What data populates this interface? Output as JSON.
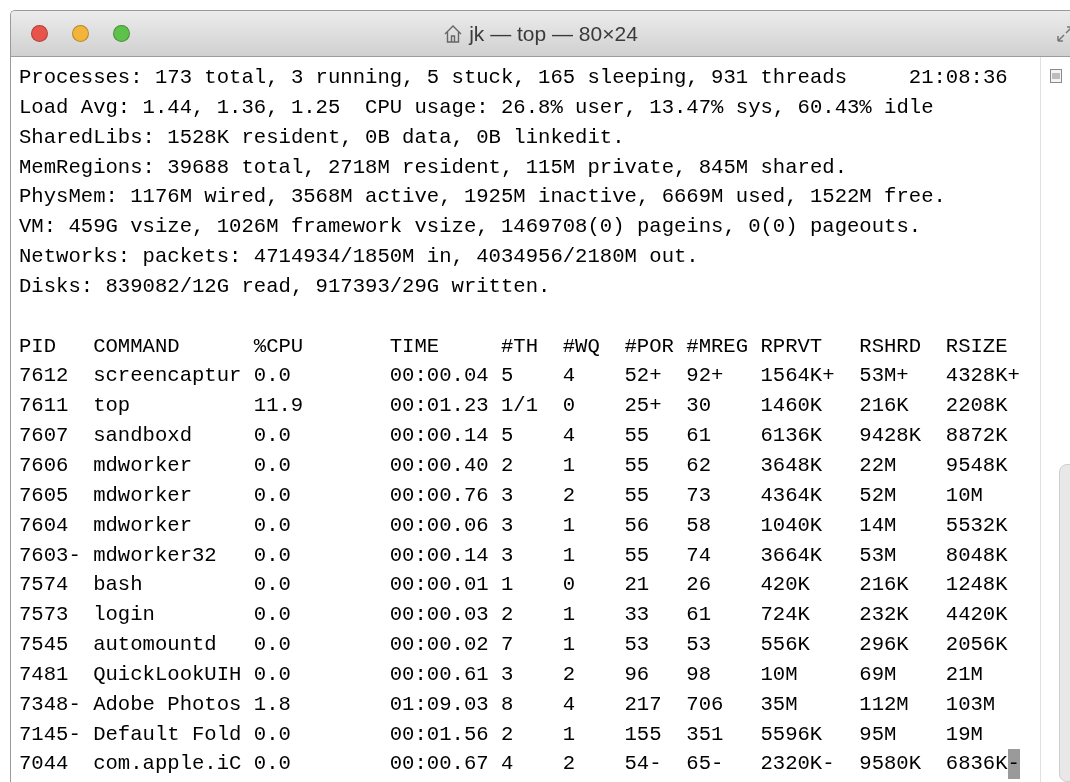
{
  "window": {
    "title": "jk — top — 80×24"
  },
  "summary": {
    "first_line": "Processes: 173 total, 3 running, 5 stuck, 165 sleeping, 931 threads",
    "clock": "21:08:36",
    "lines": [
      "Load Avg: 1.44, 1.36, 1.25  CPU usage: 26.8% user, 13.47% sys, 60.43% idle",
      "SharedLibs: 1528K resident, 0B data, 0B linkedit.",
      "MemRegions: 39688 total, 2718M resident, 115M private, 845M shared.",
      "PhysMem: 1176M wired, 3568M active, 1925M inactive, 6669M used, 1522M free.",
      "VM: 459G vsize, 1026M framework vsize, 1469708(0) pageins, 0(0) pageouts.",
      "Networks: packets: 4714934/1850M in, 4034956/2180M out.",
      "Disks: 839082/12G read, 917393/29G written."
    ]
  },
  "table": {
    "columns": [
      "PID",
      "COMMAND",
      "%CPU",
      "TIME",
      "#TH",
      "#WQ",
      "#POR",
      "#MREG",
      "RPRVT",
      "RSHRD",
      "RSIZE"
    ],
    "rows": [
      [
        "7612",
        "screencaptur",
        "0.0",
        "00:00.04",
        "5",
        "4",
        "52+",
        "92+",
        "1564K+",
        "53M+",
        "4328K+"
      ],
      [
        "7611",
        "top",
        "11.9",
        "00:01.23",
        "1/1",
        "0",
        "25+",
        "30",
        "1460K",
        "216K",
        "2208K"
      ],
      [
        "7607",
        "sandboxd",
        "0.0",
        "00:00.14",
        "5",
        "4",
        "55",
        "61",
        "6136K",
        "9428K",
        "8872K"
      ],
      [
        "7606",
        "mdworker",
        "0.0",
        "00:00.40",
        "2",
        "1",
        "55",
        "62",
        "3648K",
        "22M",
        "9548K"
      ],
      [
        "7605",
        "mdworker",
        "0.0",
        "00:00.76",
        "3",
        "2",
        "55",
        "73",
        "4364K",
        "52M",
        "10M"
      ],
      [
        "7604",
        "mdworker",
        "0.0",
        "00:00.06",
        "3",
        "1",
        "56",
        "58",
        "1040K",
        "14M",
        "5532K"
      ],
      [
        "7603-",
        "mdworker32",
        "0.0",
        "00:00.14",
        "3",
        "1",
        "55",
        "74",
        "3664K",
        "53M",
        "8048K"
      ],
      [
        "7574",
        "bash",
        "0.0",
        "00:00.01",
        "1",
        "0",
        "21",
        "26",
        "420K",
        "216K",
        "1248K"
      ],
      [
        "7573",
        "login",
        "0.0",
        "00:00.03",
        "2",
        "1",
        "33",
        "61",
        "724K",
        "232K",
        "4420K"
      ],
      [
        "7545",
        "automountd",
        "0.0",
        "00:00.02",
        "7",
        "1",
        "53",
        "53",
        "556K",
        "296K",
        "2056K"
      ],
      [
        "7481",
        "QuickLookUIH",
        "0.0",
        "00:00.61",
        "3",
        "2",
        "96",
        "98",
        "10M",
        "69M",
        "21M"
      ],
      [
        "7348-",
        "Adobe Photos",
        "1.8",
        "01:09.03",
        "8",
        "4",
        "217",
        "706",
        "35M",
        "112M",
        "103M"
      ],
      [
        "7145-",
        "Default Fold",
        "0.0",
        "00:01.56",
        "2",
        "1",
        "155",
        "351",
        "5596K",
        "95M",
        "19M"
      ],
      [
        "7044",
        "com.apple.iC",
        "0.0",
        "00:00.67",
        "4",
        "2",
        "54-",
        "65-",
        "2320K-",
        "9580K",
        "6836K"
      ]
    ]
  },
  "cursor": {
    "text": "-"
  }
}
